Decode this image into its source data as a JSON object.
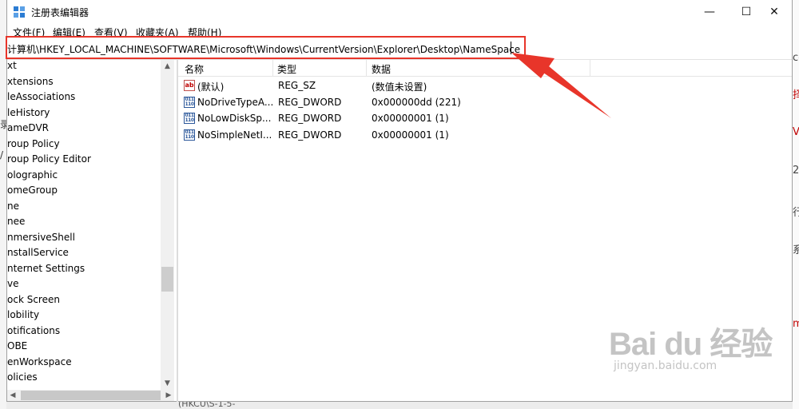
{
  "window": {
    "title": "注册表编辑器",
    "controls": {
      "minimize": "—",
      "maximize": "☐",
      "close": "✕"
    }
  },
  "menu": [
    "文件(F)",
    "编辑(E)",
    "查看(V)",
    "收藏夹(A)",
    "帮助(H)"
  ],
  "address_bar": {
    "value": "计算机\\HKEY_LOCAL_MACHINE\\SOFTWARE\\Microsoft\\Windows\\CurrentVersion\\Explorer\\Desktop\\NameSpace"
  },
  "tree": [
    "xt",
    "xtensions",
    "leAssociations",
    "leHistory",
    "ameDVR",
    "roup Policy",
    "roup Policy Editor",
    "olographic",
    "omeGroup",
    "ne",
    "nee",
    "nmersiveShell",
    "nstallService",
    "nternet Settings",
    "ve",
    "ock Screen",
    "lobility",
    "otifications",
    "OBE",
    "enWorkspace",
    "olicies"
  ],
  "list": {
    "columns": [
      "名称",
      "类型",
      "数据"
    ],
    "rows": [
      {
        "icon": "string-value-icon",
        "name": "(默认)",
        "type": "REG_SZ",
        "data": "(数值未设置)"
      },
      {
        "icon": "dword-value-icon",
        "name": "NoDriveTypeA...",
        "type": "REG_DWORD",
        "data": "0x000000dd (221)"
      },
      {
        "icon": "dword-value-icon",
        "name": "NoLowDiskSp...",
        "type": "REG_DWORD",
        "data": "0x00000001 (1)"
      },
      {
        "icon": "dword-value-icon",
        "name": "NoSimpleNetI...",
        "type": "REG_DWORD",
        "data": "0x00000001 (1)"
      }
    ]
  },
  "side_fragments": {
    "left": [
      "录",
      "/"
    ],
    "right": [
      "ce",
      "择",
      "Vi",
      "20",
      "行",
      "系",
      "m"
    ],
    "bottom": "(HKCU\\S-1-5-"
  },
  "watermark": {
    "main": "Bai du 经验",
    "sub": "jingyan.baidu.com"
  },
  "colors": {
    "highlight": "#e8352a",
    "title_icon": "#2b7cd3"
  }
}
